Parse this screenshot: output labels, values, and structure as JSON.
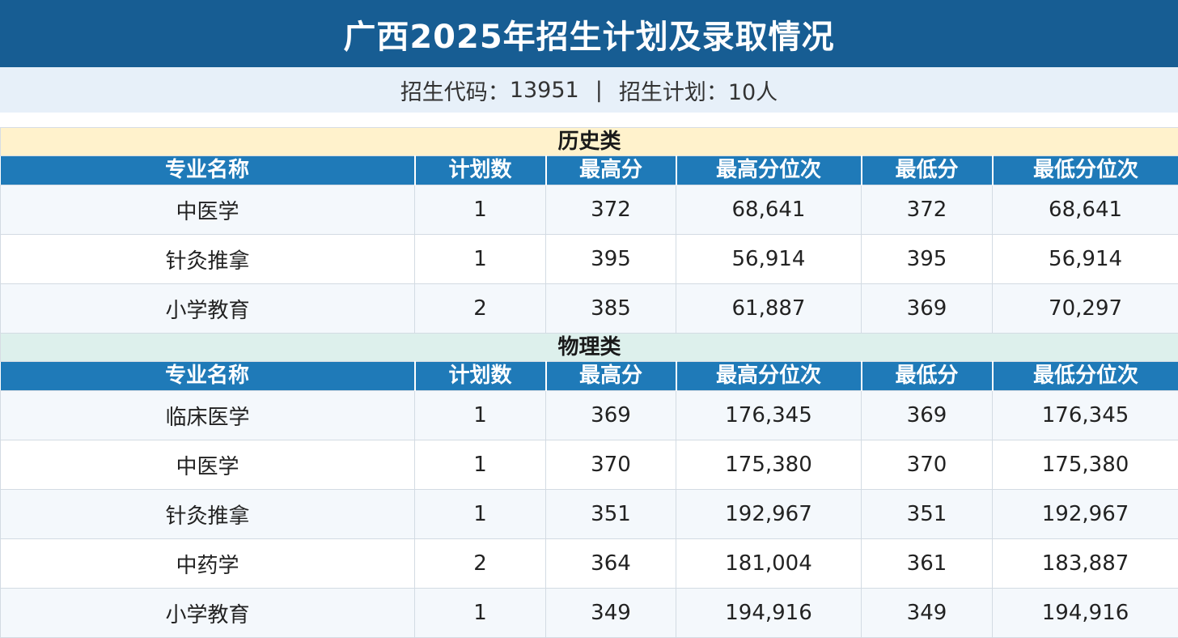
{
  "title": "广西2025年招生计划及录取情况",
  "info": {
    "code_label": "招生代码：",
    "code_value": "13951",
    "separator": "|",
    "plan_label": "招生计划：",
    "plan_value": "10人"
  },
  "columns": [
    "专业名称",
    "计划数",
    "最高分",
    "最高分位次",
    "最低分",
    "最低分位次"
  ],
  "sections": [
    {
      "name": "历史类",
      "rows": [
        [
          "中医学",
          "1",
          "372",
          "68,641",
          "372",
          "68,641"
        ],
        [
          "针灸推拿",
          "1",
          "395",
          "56,914",
          "395",
          "56,914"
        ],
        [
          "小学教育",
          "2",
          "385",
          "61,887",
          "369",
          "70,297"
        ]
      ]
    },
    {
      "name": "物理类",
      "rows": [
        [
          "临床医学",
          "1",
          "369",
          "176,345",
          "369",
          "176,345"
        ],
        [
          "中医学",
          "1",
          "370",
          "175,380",
          "370",
          "175,380"
        ],
        [
          "针灸推拿",
          "1",
          "351",
          "192,967",
          "351",
          "192,967"
        ],
        [
          "中药学",
          "2",
          "364",
          "181,004",
          "361",
          "183,887"
        ],
        [
          "小学教育",
          "1",
          "349",
          "194,916",
          "349",
          "194,916"
        ]
      ]
    }
  ]
}
